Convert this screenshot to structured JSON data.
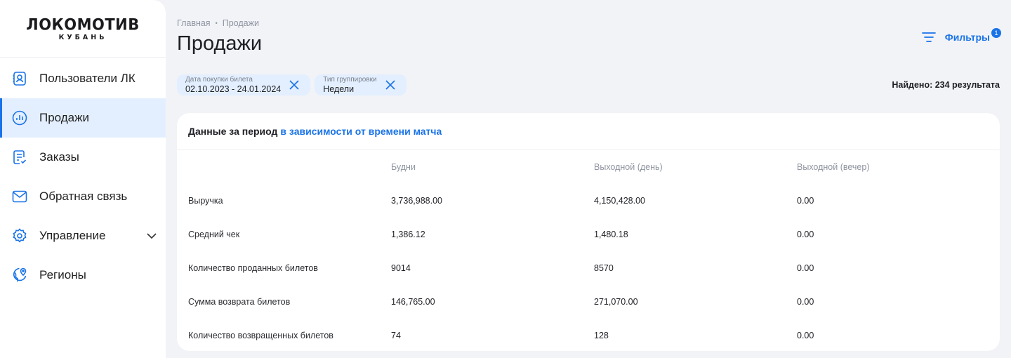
{
  "logo": {
    "main": "ЛОКОМОТИВ",
    "sub": "КУБАНЬ"
  },
  "sidebar": {
    "items": [
      {
        "label": "Пользователи ЛК",
        "icon": "user-card-icon"
      },
      {
        "label": "Продажи",
        "icon": "chart-circle-icon",
        "active": true
      },
      {
        "label": "Заказы",
        "icon": "receipt-icon"
      },
      {
        "label": "Обратная связь",
        "icon": "mail-icon"
      },
      {
        "label": "Управление",
        "icon": "gear-icon",
        "expandable": true
      },
      {
        "label": "Регионы",
        "icon": "globe-pin-icon"
      }
    ]
  },
  "breadcrumb": {
    "home": "Главная",
    "current": "Продажи"
  },
  "page": {
    "title": "Продажи"
  },
  "filters": {
    "label": "Фильтры",
    "badge": "1"
  },
  "chips": [
    {
      "label": "Дата покупки билета",
      "value": "02.10.2023 - 24.01.2024"
    },
    {
      "label": "Тип группировки",
      "value": "Недели"
    }
  ],
  "found": "Найдено: 234 результата",
  "card": {
    "title": "Данные за период",
    "link": "в зависимости от времени матча",
    "columns": [
      "",
      "Будни",
      "Выходной (день)",
      "Выходной (вечер)"
    ],
    "rows": [
      [
        "Выручка",
        "3,736,988.00",
        "4,150,428.00",
        "0.00"
      ],
      [
        "Средний чек",
        "1,386.12",
        "1,480.18",
        "0.00"
      ],
      [
        "Количество проданных билетов",
        "9014",
        "8570",
        "0.00"
      ],
      [
        "Сумма возврата билетов",
        "146,765.00",
        "271,070.00",
        "0.00"
      ],
      [
        "Количество возвращенных билетов",
        "74",
        "128",
        "0.00"
      ]
    ]
  },
  "colors": {
    "accent": "#1a73e8",
    "active_bg": "#e3efff",
    "page_bg": "#f1f3f7"
  }
}
